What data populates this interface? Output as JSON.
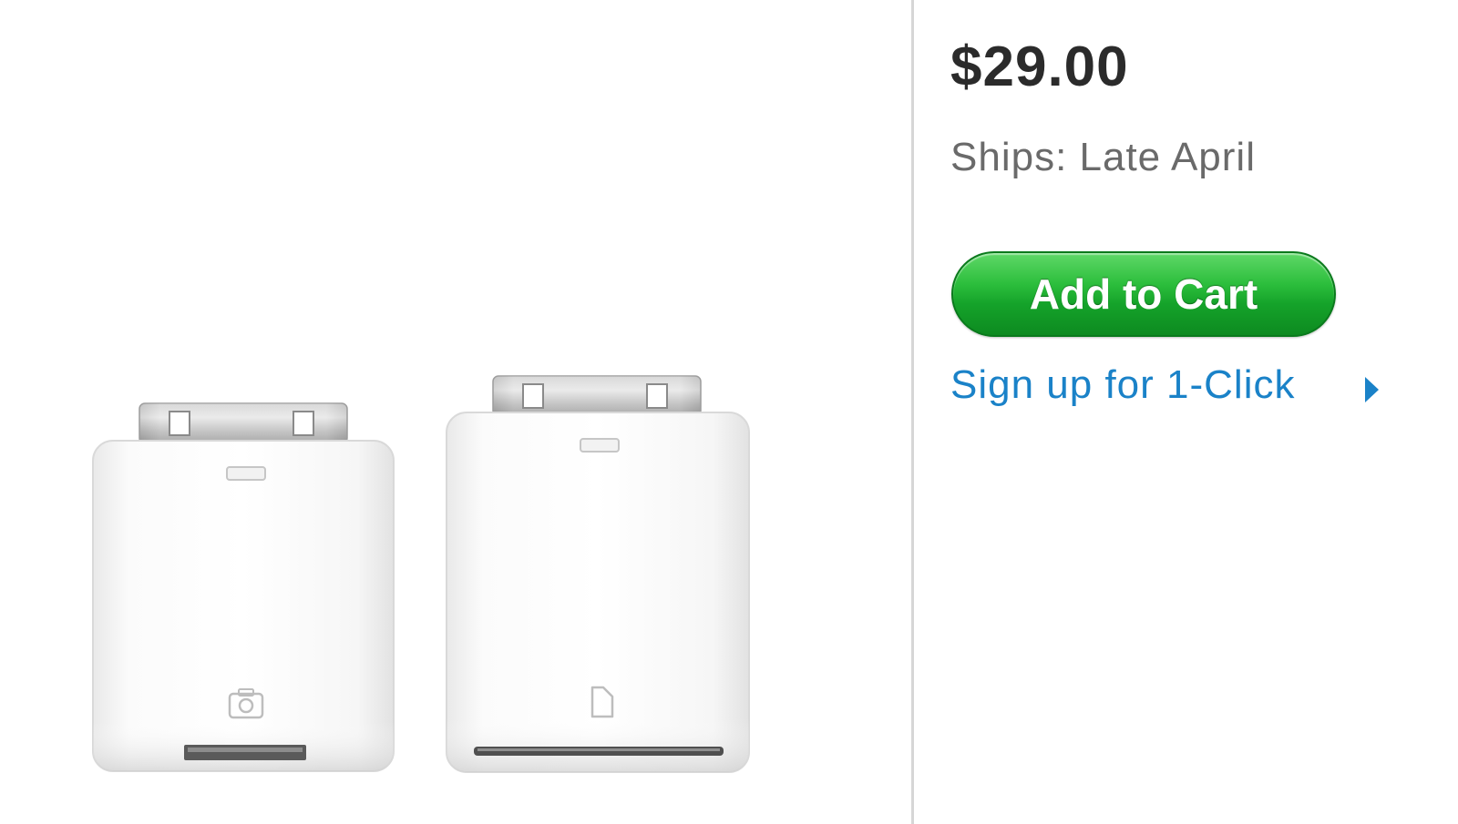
{
  "product": {
    "price": "$29.00",
    "shipping": "Ships: Late April",
    "add_to_cart_label": "Add to Cart",
    "signup_link_label": "Sign up for 1-Click",
    "signup_arrow_icon": "chevron-right-icon",
    "image": {
      "items": [
        "camera-connector-adapter",
        "sd-card-reader-adapter"
      ],
      "icons": [
        "camera-icon",
        "sd-card-icon"
      ]
    }
  },
  "colors": {
    "button_green": "#1fae33",
    "link_blue": "#1a82c8",
    "price_text": "#2b2b2b",
    "ships_text": "#6a6a6a",
    "divider": "#d6d6d6"
  }
}
